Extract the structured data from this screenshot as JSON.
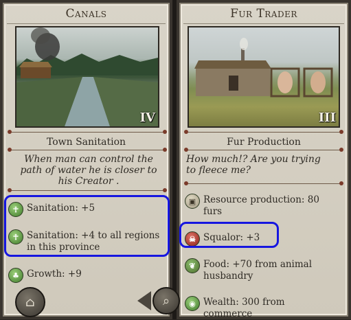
{
  "left_card": {
    "title": "Canals",
    "tier": "IV",
    "subtitle": "Town Sanitation",
    "quote": "When man can control the path of water he is closer to his Creator .",
    "effects": [
      {
        "icon": "sanitation-icon",
        "text": "Sanitation: +5"
      },
      {
        "icon": "sanitation-icon",
        "text": "Sanitation: +4 to all regions in this province"
      },
      {
        "icon": "growth-icon",
        "text": "Growth: +9"
      }
    ]
  },
  "right_card": {
    "title": "Fur Trader",
    "tier": "III",
    "subtitle": "Fur Production",
    "quote": "How much!? Are you trying to fleece me?",
    "effects": [
      {
        "icon": "resource-crate-icon",
        "text": "Resource production: 80 furs"
      },
      {
        "icon": "squalor-icon",
        "text": "Squalor: +3"
      },
      {
        "icon": "food-icon",
        "text": "Food: +70 from animal husbandry"
      },
      {
        "icon": "wealth-icon",
        "text": "Wealth: 300 from commerce"
      }
    ]
  },
  "controls": {
    "left_button_icon": "building-browser-icon",
    "back_arrow_icon": "back-arrow-icon",
    "zoom_icon": "magnifier-icon"
  },
  "colors": {
    "highlight": "#1616e0",
    "panel": "#d5cfc2"
  }
}
